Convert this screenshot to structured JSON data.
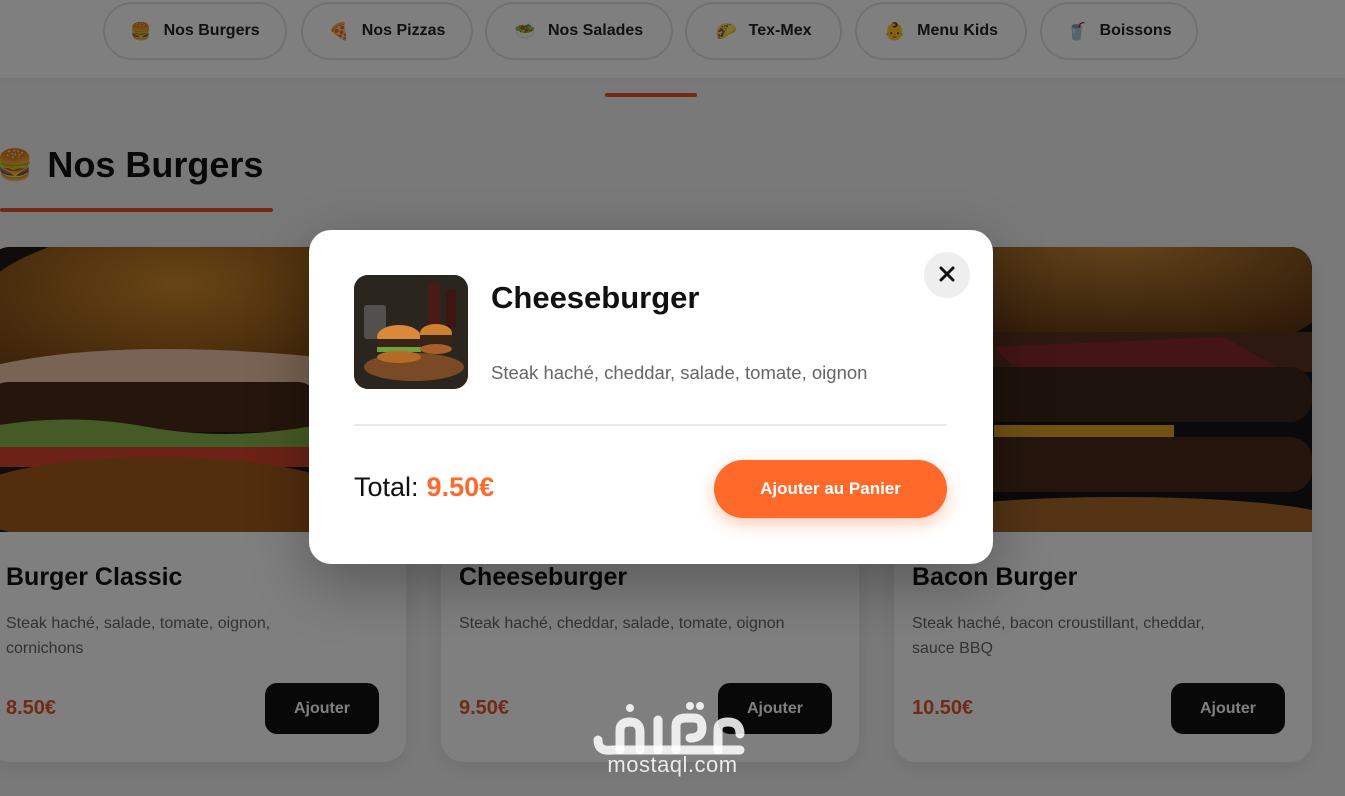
{
  "nav": {
    "categories": [
      {
        "label": "Nos Burgers",
        "icon": "burger-icon",
        "glyph": "🍔"
      },
      {
        "label": "Nos Pizzas",
        "icon": "pizza-icon",
        "glyph": "🍕"
      },
      {
        "label": "Nos Salades",
        "icon": "salad-icon",
        "glyph": "🥗"
      },
      {
        "label": "Tex-Mex",
        "icon": "taco-icon",
        "glyph": "🌮"
      },
      {
        "label": "Menu Kids",
        "icon": "child-icon",
        "glyph": "👶"
      },
      {
        "label": "Boissons",
        "icon": "drink-icon",
        "glyph": "🥤"
      }
    ],
    "active_index": 2
  },
  "section": {
    "title": "Nos Burgers",
    "icon": "burger-icon",
    "glyph": "🍔"
  },
  "products": [
    {
      "name": "Burger Classic",
      "description": "Steak haché, salade, tomate, oignon, cornichons",
      "price": "8.50€",
      "add_label": "Ajouter"
    },
    {
      "name": "Cheeseburger",
      "description": "Steak haché, cheddar, salade, tomate, oignon",
      "price": "9.50€",
      "add_label": "Ajouter"
    },
    {
      "name": "Bacon Burger",
      "description": "Steak haché, bacon croustillant, cheddar, sauce BBQ",
      "price": "10.50€",
      "add_label": "Ajouter"
    }
  ],
  "modal": {
    "title": "Cheeseburger",
    "description": "Steak haché, cheddar, salade, tomate, oignon",
    "total_label": "Total:",
    "total_value": "9.50€",
    "cart_button": "Ajouter au Panier",
    "close_icon": "close-icon"
  },
  "watermark": {
    "text": "mostaql.com",
    "logo": "مستقل"
  },
  "colors": {
    "accent": "#ff6a2b",
    "price": "#e2552a",
    "dark_button": "#111111"
  }
}
